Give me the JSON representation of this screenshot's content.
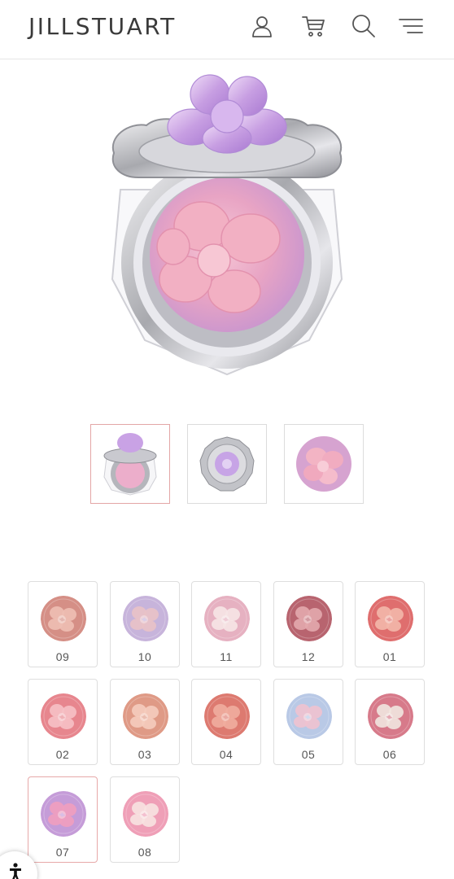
{
  "header": {
    "logo": "JILLSTUART",
    "icons": [
      "account-icon",
      "cart-icon",
      "search-icon",
      "menu-icon"
    ]
  },
  "gallery": {
    "thumbnails": [
      "compact-front",
      "compact-lid-top",
      "powder-close-up"
    ],
    "active_index": 0
  },
  "shades": {
    "codes": [
      "09",
      "10",
      "11",
      "12",
      "01",
      "02",
      "03",
      "04",
      "05",
      "06",
      "07",
      "08"
    ],
    "selected": "07",
    "colors": {
      "09": [
        "#d58f86",
        "#eebfb4"
      ],
      "10": [
        "#c7b4db",
        "#e9c2c6"
      ],
      "11": [
        "#e6b1c1",
        "#f6e6e6"
      ],
      "12": [
        "#b8646f",
        "#e3a8ad"
      ],
      "01": [
        "#df6e6e",
        "#f3b7aa"
      ],
      "02": [
        "#e7868e",
        "#f6c1c5"
      ],
      "03": [
        "#df9a86",
        "#f5ccbe"
      ],
      "04": [
        "#dd7a70",
        "#f0ad9f"
      ],
      "05": [
        "#b9c9e6",
        "#efc2cf"
      ],
      "06": [
        "#d77a8a",
        "#f1e6df"
      ],
      "07": [
        "#c59cd8",
        "#ef9fbf"
      ],
      "08": [
        "#ef9fb7",
        "#f7e2e1"
      ]
    }
  },
  "accessibility": {
    "icon": "accessibility-icon"
  }
}
